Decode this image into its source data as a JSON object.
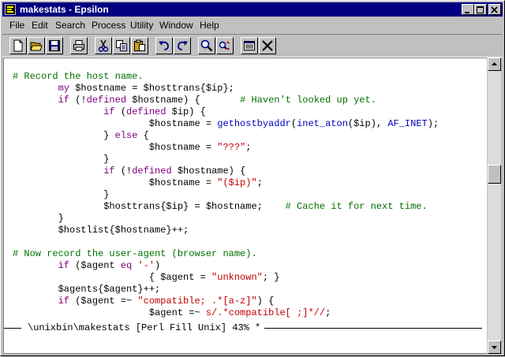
{
  "window": {
    "title": "makestats - Epsilon"
  },
  "menu": [
    "File",
    "Edit",
    "Search",
    "Process",
    "Utility",
    "Window",
    "Help"
  ],
  "toolbar": [
    {
      "name": "new-file-icon"
    },
    {
      "name": "open-folder-icon"
    },
    {
      "name": "save-disk-icon"
    },
    {
      "name": "print-icon"
    },
    {
      "name": "cut-scissors-icon"
    },
    {
      "name": "copy-icon"
    },
    {
      "name": "paste-icon"
    },
    {
      "name": "undo-icon"
    },
    {
      "name": "redo-icon"
    },
    {
      "name": "search-icon"
    },
    {
      "name": "replace-icon"
    },
    {
      "name": "buffer-list-icon"
    },
    {
      "name": "close-icon"
    }
  ],
  "code_lines": [
    [
      {
        "t": "# Record the host name.",
        "c": "cm"
      }
    ],
    [
      {
        "t": "        "
      },
      {
        "t": "my",
        "c": "kw"
      },
      {
        "t": " $hostname = $hosttrans{$ip};"
      }
    ],
    [
      {
        "t": "        "
      },
      {
        "t": "if",
        "c": "kw"
      },
      {
        "t": " (!"
      },
      {
        "t": "defined",
        "c": "kw"
      },
      {
        "t": " $hostname) {       "
      },
      {
        "t": "# Haven't looked up yet.",
        "c": "cm"
      }
    ],
    [
      {
        "t": "                "
      },
      {
        "t": "if",
        "c": "kw"
      },
      {
        "t": " ("
      },
      {
        "t": "defined",
        "c": "kw"
      },
      {
        "t": " $ip) {"
      }
    ],
    [
      {
        "t": "                        $hostname = "
      },
      {
        "t": "gethostbyaddr",
        "c": "fn"
      },
      {
        "t": "("
      },
      {
        "t": "inet_aton",
        "c": "fn"
      },
      {
        "t": "($ip), "
      },
      {
        "t": "AF_INET",
        "c": "fn"
      },
      {
        "t": ");"
      }
    ],
    [
      {
        "t": "                } "
      },
      {
        "t": "else",
        "c": "kw"
      },
      {
        "t": " {"
      }
    ],
    [
      {
        "t": "                        $hostname = "
      },
      {
        "t": "\"???\"",
        "c": "st"
      },
      {
        "t": ";"
      }
    ],
    [
      {
        "t": "                }"
      }
    ],
    [
      {
        "t": "                "
      },
      {
        "t": "if",
        "c": "kw"
      },
      {
        "t": " (!"
      },
      {
        "t": "defined",
        "c": "kw"
      },
      {
        "t": " $hostname) {"
      }
    ],
    [
      {
        "t": "                        $hostname = "
      },
      {
        "t": "\"($ip)\"",
        "c": "st"
      },
      {
        "t": ";"
      }
    ],
    [
      {
        "t": "                }"
      }
    ],
    [
      {
        "t": "                $hosttrans{$ip} = $hostname;    "
      },
      {
        "t": "# Cache it for next time.",
        "c": "cm"
      }
    ],
    [
      {
        "t": "        }"
      }
    ],
    [
      {
        "t": "        $hostlist{$hostname}++;"
      }
    ],
    [
      {
        "t": ""
      }
    ],
    [
      {
        "t": "# Now record the user-agent (browser name).",
        "c": "cm"
      }
    ],
    [
      {
        "t": "        "
      },
      {
        "t": "if",
        "c": "kw"
      },
      {
        "t": " ($agent "
      },
      {
        "t": "eq",
        "c": "kw"
      },
      {
        "t": " "
      },
      {
        "t": "'-'",
        "c": "st"
      },
      {
        "t": ")"
      }
    ],
    [
      {
        "t": "                        { $agent = "
      },
      {
        "t": "\"unknown\"",
        "c": "st"
      },
      {
        "t": "; }"
      }
    ],
    [
      {
        "t": "        $agents{$agent}++;"
      }
    ],
    [
      {
        "t": "        "
      },
      {
        "t": "if",
        "c": "kw"
      },
      {
        "t": " ($agent =~ "
      },
      {
        "t": "\"compatible; .*[a-z]\"",
        "c": "st"
      },
      {
        "t": ") {"
      }
    ],
    [
      {
        "t": "                        $agent =~ "
      },
      {
        "t": "s/.*compatible[ ;]*//",
        "c": "st"
      },
      {
        "t": ";"
      }
    ]
  ],
  "status": {
    "text": "\\unixbin\\makestats [Perl Fill Unix] 43% *"
  },
  "colors": {
    "titlebar": "#000080",
    "comment": "#007000",
    "keyword": "#800080",
    "function": "#0000c0",
    "string": "#c00000"
  }
}
